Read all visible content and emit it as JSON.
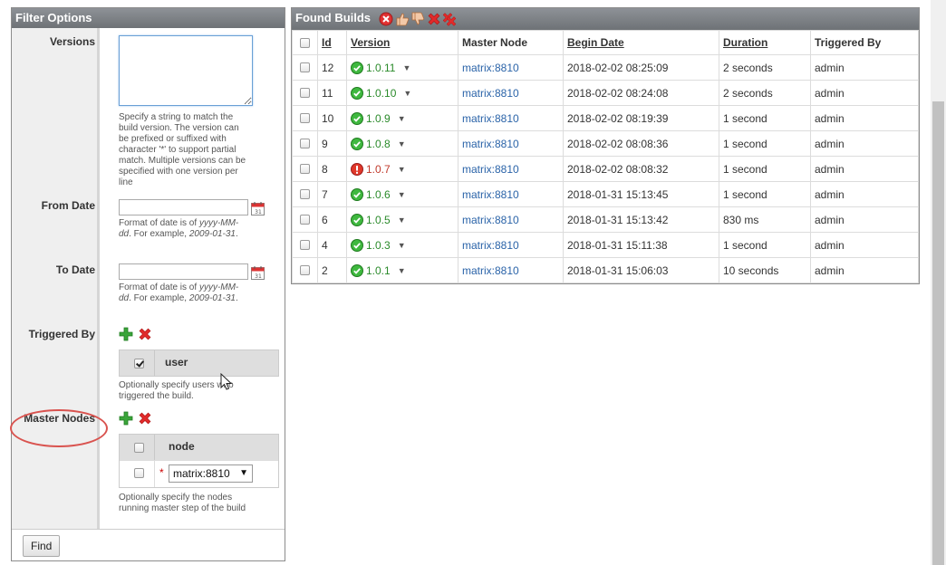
{
  "filter": {
    "title": "Filter Options",
    "versions": {
      "label": "Versions",
      "value": "",
      "help": "Specify a string to match the build version. The version can be prefixed or suffixed with character '*' to support partial match. Multiple versions can be specified with one version per line"
    },
    "from_date": {
      "label": "From Date",
      "help_prefix": "Format of date is of ",
      "help_format": "yyyy-MM-dd",
      "help_mid": ". For example, ",
      "help_example": "2009-01-31",
      "help_suffix": "."
    },
    "to_date": {
      "label": "To Date",
      "help_prefix": "Format of date is of ",
      "help_format": "yyyy-MM-dd",
      "help_mid": ". For example, ",
      "help_example": "2009-01-31",
      "help_suffix": "."
    },
    "triggered_by": {
      "label": "Triggered By",
      "column": "user",
      "help": "Optionally specify users who triggered the build."
    },
    "master_nodes": {
      "label": "Master Nodes",
      "column": "node",
      "selected": "matrix:8810",
      "help": "Optionally specify the nodes running master step of the build"
    },
    "find_label": "Find"
  },
  "results": {
    "title": "Found Builds",
    "columns": {
      "id": "Id",
      "version": "Version",
      "master_node": "Master Node",
      "begin_date": "Begin Date",
      "duration": "Duration",
      "triggered_by": "Triggered By"
    },
    "rows": [
      {
        "id": "12",
        "version": "1.0.11",
        "status": "success",
        "node": "matrix:8810",
        "begin": "2018-02-02 08:25:09",
        "duration": "2 seconds",
        "user": "admin"
      },
      {
        "id": "11",
        "version": "1.0.10",
        "status": "success",
        "node": "matrix:8810",
        "begin": "2018-02-02 08:24:08",
        "duration": "2 seconds",
        "user": "admin"
      },
      {
        "id": "10",
        "version": "1.0.9",
        "status": "success",
        "node": "matrix:8810",
        "begin": "2018-02-02 08:19:39",
        "duration": "1 second",
        "user": "admin"
      },
      {
        "id": "9",
        "version": "1.0.8",
        "status": "success",
        "node": "matrix:8810",
        "begin": "2018-02-02 08:08:36",
        "duration": "1 second",
        "user": "admin"
      },
      {
        "id": "8",
        "version": "1.0.7",
        "status": "failed",
        "node": "matrix:8810",
        "begin": "2018-02-02 08:08:32",
        "duration": "1 second",
        "user": "admin"
      },
      {
        "id": "7",
        "version": "1.0.6",
        "status": "success",
        "node": "matrix:8810",
        "begin": "2018-01-31 15:13:45",
        "duration": "1 second",
        "user": "admin"
      },
      {
        "id": "6",
        "version": "1.0.5",
        "status": "success",
        "node": "matrix:8810",
        "begin": "2018-01-31 15:13:42",
        "duration": "830 ms",
        "user": "admin"
      },
      {
        "id": "4",
        "version": "1.0.3",
        "status": "success",
        "node": "matrix:8810",
        "begin": "2018-01-31 15:11:38",
        "duration": "1 second",
        "user": "admin"
      },
      {
        "id": "2",
        "version": "1.0.1",
        "status": "success",
        "node": "matrix:8810",
        "begin": "2018-01-31 15:06:03",
        "duration": "10 seconds",
        "user": "admin"
      }
    ]
  },
  "colors": {
    "header_bg": "#7a7e83",
    "success": "#2a8a2a",
    "failed": "#c0392b",
    "link": "#2a63a8",
    "highlight": "#d9534f"
  }
}
